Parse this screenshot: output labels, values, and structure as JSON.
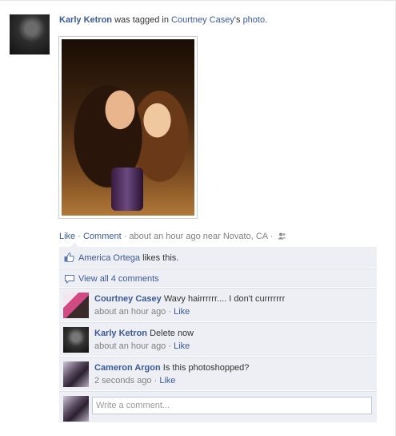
{
  "story": {
    "actor": "Karly Ketron",
    "verb": " was tagged in ",
    "owner_possessive": "Courtney Casey",
    "apostrophe": "'s ",
    "object": "photo",
    "period": "."
  },
  "actions": {
    "like": "Like",
    "sep1": " · ",
    "comment": "Comment",
    "sep2": " · ",
    "time": "about an hour ago near Novato, CA",
    "sep3": " · "
  },
  "likes": {
    "person": "America Ortega",
    "suffix": " likes this."
  },
  "view_all": "View all 4 comments",
  "comments": [
    {
      "author": "Courtney Casey",
      "text": " Wavy hairrrrrr.... I don't currrrrrr",
      "time": "about an hour ago",
      "sep": " · ",
      "like": "Like"
    },
    {
      "author": "Karly Ketron",
      "text": " Delete now",
      "time": "about an hour ago",
      "sep": " · ",
      "like": "Like"
    },
    {
      "author": "Cameron Argon",
      "text": " Is this photoshopped?",
      "time": "2 seconds ago",
      "sep": " · ",
      "like": "Like"
    }
  ],
  "composer": {
    "placeholder": "Write a comment..."
  },
  "colors": {
    "link": "#3b5998",
    "ufi_bg": "#edeff4",
    "meta": "#808080"
  }
}
